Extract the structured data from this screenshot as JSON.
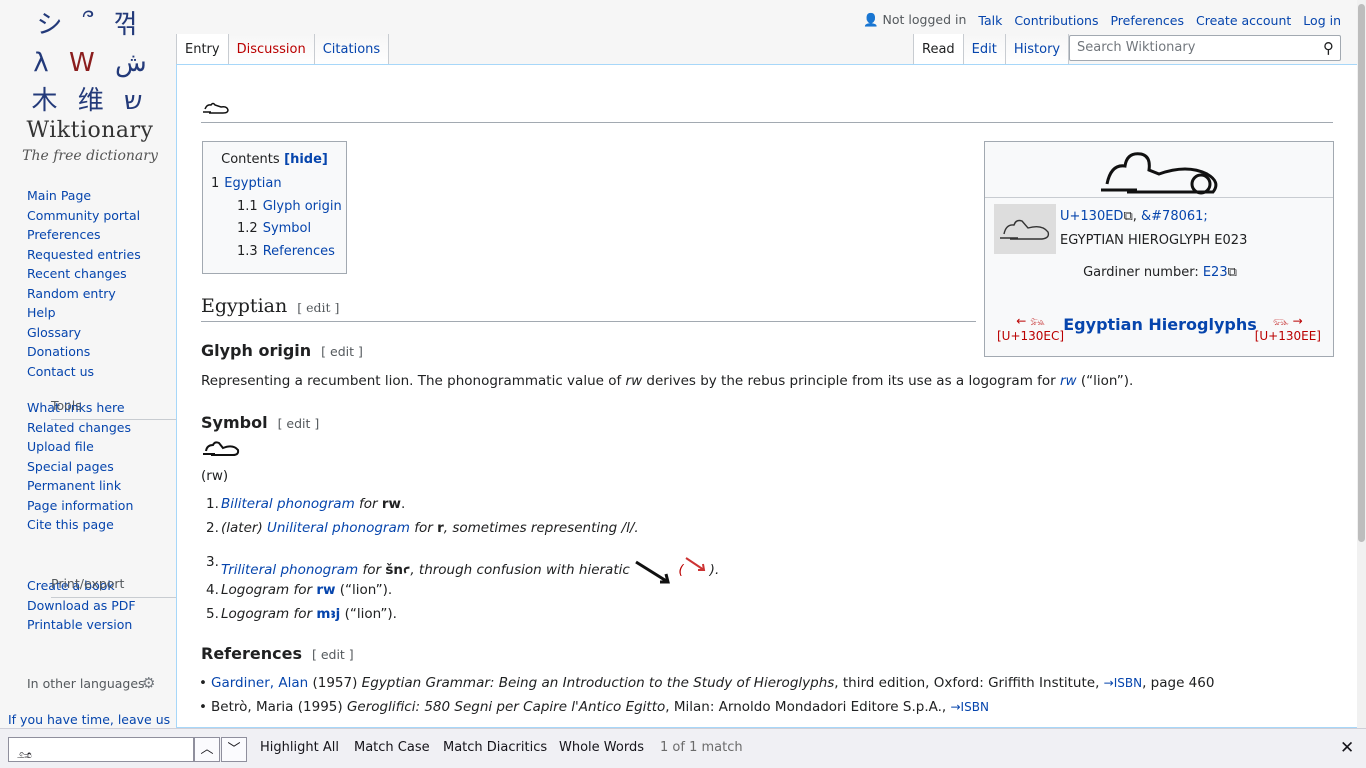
{
  "logo": {
    "wordmark": "Wiktionary",
    "tagline": "The free dictionary"
  },
  "sidebar": {
    "navigation": [
      "Main Page",
      "Community portal",
      "Preferences",
      "Requested entries",
      "Recent changes",
      "Random entry",
      "Help",
      "Glossary",
      "Donations",
      "Contact us"
    ],
    "tools_heading": "Tools",
    "tools": [
      "What links here",
      "Related changes",
      "Upload file",
      "Special pages",
      "Permanent link",
      "Page information",
      "Cite this page"
    ],
    "print_heading": "Print/export",
    "print": [
      "Create a book",
      "Download as PDF",
      "Printable version"
    ],
    "languages": "In other languages",
    "leave_note": "If you have time, leave us"
  },
  "personal": {
    "status": "Not logged in",
    "links": [
      "Talk",
      "Contributions",
      "Preferences",
      "Create account",
      "Log in"
    ]
  },
  "tabs": {
    "entry": "Entry",
    "discussion": "Discussion",
    "citations": "Citations",
    "read": "Read",
    "edit": "Edit",
    "history": "History"
  },
  "search": {
    "placeholder": "Search Wiktionary"
  },
  "page": {
    "title": "𓃭"
  },
  "toc": {
    "title": "Contents",
    "hide": "[hide]",
    "items": [
      {
        "num": "1",
        "label": "Egyptian"
      },
      {
        "num": "1.1",
        "label": "Glyph origin"
      },
      {
        "num": "1.2",
        "label": "Symbol"
      },
      {
        "num": "1.3",
        "label": "References"
      }
    ]
  },
  "infobox": {
    "codepoint": "U+130ED",
    "entity": "&#78061;",
    "name": "EGYPTIAN HIEROGLYPH E023",
    "gardiner_label": "Gardiner number:",
    "gardiner_code": "E23",
    "prev_arrow": "←",
    "prev_code": "[U+130EC]",
    "next_arrow": "→",
    "next_code": "[U+130EE]",
    "block": "Egyptian Hieroglyphs"
  },
  "sections": {
    "egyptian": "Egyptian",
    "glyph_origin": "Glyph origin",
    "symbol": "Symbol",
    "references": "References",
    "edit": "[ edit ]"
  },
  "glyph_origin": {
    "t1": "Representing a recumbent lion. The phonogrammatic value of ",
    "rw": "rw",
    "t2": " derives by the rebus principle from its use as a logogram for ",
    "t3": " (“lion”)."
  },
  "symbol": {
    "transliteration": "(rw)",
    "item1": {
      "n": "1.",
      "link": "Biliteral phonogram",
      "mid": " for ",
      "val": "rw",
      "end": "."
    },
    "item2": {
      "n": "2.",
      "pre": "(later) ",
      "link": "Uniliteral phonogram",
      "mid": " for ",
      "val": "r",
      "end": ", sometimes representing /l/."
    },
    "item3": {
      "n": "3.",
      "link": "Triliteral phonogram",
      "mid": " for ",
      "val": "šnꜥ",
      "end": ", through confusion with hieratic",
      "paren_open": " (",
      "paren_close": ")."
    },
    "item4": {
      "n": "4.",
      "pre": "Logogram",
      "mid": " for ",
      "val": "rw",
      "end": " (“lion”)."
    },
    "item5": {
      "n": "5.",
      "pre": "Logogram",
      "mid": " for ",
      "val": "mꜣj",
      "end": " (“lion”)."
    }
  },
  "references": {
    "r1": {
      "author": "Gardiner, Alan",
      "year": " (1957) ",
      "title": "Egyptian Grammar: Being an Introduction to the Study of Hieroglyphs",
      "rest": ", third edition, Oxford: Griffith Institute, ",
      "isbn": "→ISBN",
      "page": ", page 460"
    },
    "r2": {
      "author": "Betrò, Maria",
      "year": " (1995) ",
      "title": "Geroglifici: 580 Segni per Capire l'Antico Egitto",
      "rest": ", Milan: Arnoldo Mondadori Editore S.p.A., ",
      "isbn": "→ISBN"
    }
  },
  "findbar": {
    "query": "𓃭",
    "highlight": "Highlight All",
    "match_case": "Match Case",
    "diacritics": "Match Diacritics",
    "whole_words": "Whole Words",
    "status": "1 of 1 match"
  }
}
